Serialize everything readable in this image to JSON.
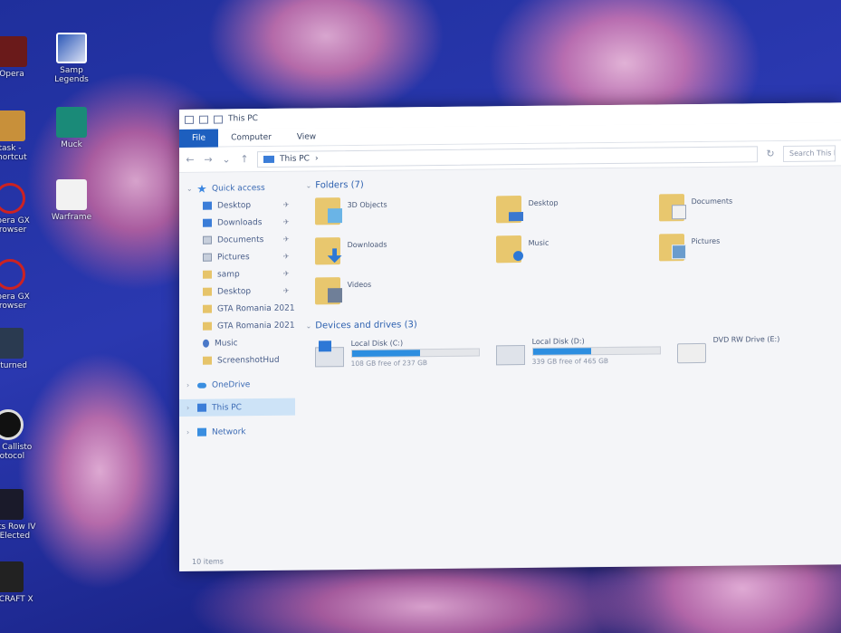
{
  "desktop": {
    "icons": [
      {
        "label": "Opera"
      },
      {
        "label": "Samp\nLegends"
      },
      {
        "label": "task -\nshortcut"
      },
      {
        "label": "Muck"
      },
      {
        "label": "Opera GX\nBrowser"
      },
      {
        "label": "Warframe"
      },
      {
        "label": "Opera GX\nBrowser"
      },
      {
        "label": "Unturned"
      },
      {
        "label": "The Callisto\nProtocol"
      },
      {
        "label": "Saints Row IV\nRe-Elected"
      },
      {
        "label": "CALCRAFT X"
      }
    ]
  },
  "window": {
    "title": "This PC",
    "ribbon_tabs": [
      "File",
      "Computer",
      "View"
    ],
    "address": "This PC",
    "search_placeholder": "Search This PC",
    "nav": {
      "quick_access": "Quick access",
      "quick_items": [
        {
          "label": "Desktop",
          "pinned": true
        },
        {
          "label": "Downloads",
          "pinned": true
        },
        {
          "label": "Documents",
          "pinned": true
        },
        {
          "label": "Pictures",
          "pinned": true
        },
        {
          "label": "samp",
          "pinned": true
        },
        {
          "label": "Desktop",
          "pinned": true
        },
        {
          "label": "GTA Romania 2021",
          "pinned": false
        },
        {
          "label": "GTA Romania 2021",
          "pinned": false
        },
        {
          "label": "Music",
          "pinned": false
        },
        {
          "label": "ScreenshotHud",
          "pinned": false
        }
      ],
      "onedrive": "OneDrive",
      "this_pc": "This PC",
      "network": "Network",
      "pin_glyph": "✈"
    },
    "folders_header": "Folders (7)",
    "folders": [
      {
        "name": "3D Objects",
        "icon": "3d-objects-folder-icon"
      },
      {
        "name": "Desktop",
        "icon": "desktop-folder-icon"
      },
      {
        "name": "Documents",
        "icon": "documents-folder-icon"
      },
      {
        "name": "Downloads",
        "icon": "downloads-folder-icon"
      },
      {
        "name": "Music",
        "icon": "music-folder-icon"
      },
      {
        "name": "Pictures",
        "icon": "pictures-folder-icon"
      },
      {
        "name": "Videos",
        "icon": "videos-folder-icon"
      }
    ],
    "devices_header": "Devices and drives (3)",
    "drives": [
      {
        "name": "Local Disk (C:)",
        "free": "108 GB free of 237 GB",
        "used_fraction": 0.54
      },
      {
        "name": "Local Disk (D:)",
        "free": "339 GB free of 465 GB",
        "used_fraction": 0.46
      },
      {
        "name": "DVD RW Drive (E:)",
        "free": "",
        "used_fraction": null
      }
    ],
    "status": "10 items",
    "accent_color": "#1d5fbf"
  }
}
